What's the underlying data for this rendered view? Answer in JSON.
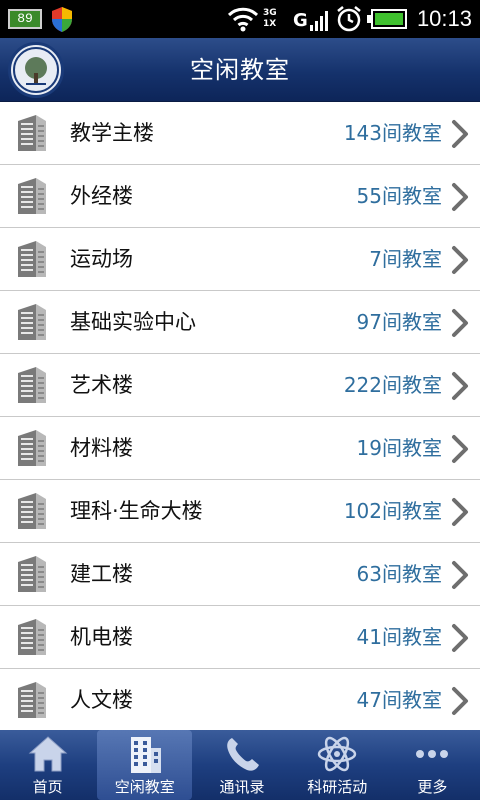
{
  "status_bar": {
    "battery_badge": "89",
    "net_top": "3G",
    "net_bottom": "1X",
    "signal_letter": "G",
    "time": "10:13"
  },
  "header": {
    "title": "空闲教室"
  },
  "buildings": [
    {
      "name": "教学主楼",
      "count": "143间教室"
    },
    {
      "name": "外经楼",
      "count": "55间教室"
    },
    {
      "name": "运动场",
      "count": "7间教室"
    },
    {
      "name": "基础实验中心",
      "count": "97间教室"
    },
    {
      "name": "艺术楼",
      "count": "222间教室"
    },
    {
      "name": "材料楼",
      "count": "19间教室"
    },
    {
      "name": "理科·生命大楼",
      "count": "102间教室"
    },
    {
      "name": "建工楼",
      "count": "63间教室"
    },
    {
      "name": "机电楼",
      "count": "41间教室"
    },
    {
      "name": "人文楼",
      "count": "47间教室"
    }
  ],
  "tabs": [
    {
      "label": "首页",
      "icon": "home-icon"
    },
    {
      "label": "空闲教室",
      "icon": "building-icon"
    },
    {
      "label": "通讯录",
      "icon": "phone-icon"
    },
    {
      "label": "科研活动",
      "icon": "atom-icon"
    },
    {
      "label": "更多",
      "icon": "more-icon"
    }
  ],
  "active_tab": 1,
  "colors": {
    "header": "#15326c",
    "count_text": "#2f6e9e",
    "nav": "#1e3f80"
  }
}
